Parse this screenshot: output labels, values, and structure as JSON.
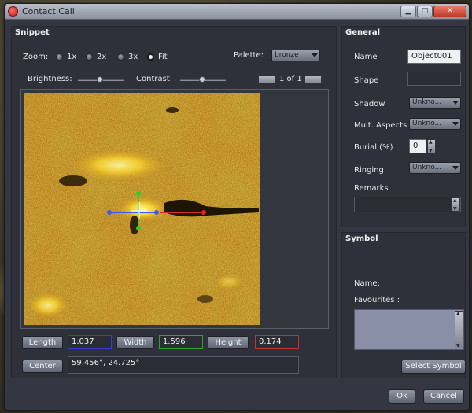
{
  "window": {
    "title": "Contact Call"
  },
  "snippet": {
    "header": "Snippet",
    "zoom_label": "Zoom:",
    "zoom_options": [
      "1x",
      "2x",
      "3x",
      "Fit"
    ],
    "zoom_selected": "Fit",
    "palette_label": "Palette:",
    "palette_value": "bronze",
    "brightness_label": "Brightness:",
    "contrast_label": "Contrast:",
    "page_indicator": "1 of 1",
    "length_button": "Length",
    "length_value": "1.037",
    "width_button": "Width",
    "width_value": "1.596",
    "height_button": "Height",
    "height_value": "0.174",
    "center_button": "Center",
    "center_value": "59.456°, 24.725°"
  },
  "general": {
    "header": "General",
    "name_label": "Name",
    "name_value": "Object001",
    "shape_label": "Shape",
    "shadow_label": "Shadow",
    "shadow_value": "Unkno...",
    "mult_aspects_label": "Mult. Aspects",
    "mult_aspects_value": "Unkno...",
    "burial_label": "Burial (%)",
    "burial_value": "0",
    "ringing_label": "Ringing",
    "ringing_value": "Unkno...",
    "remarks_label": "Remarks"
  },
  "symbol": {
    "header": "Symbol",
    "name_label": "Name:",
    "favourites_label": "Favourites :",
    "select_button": "Select Symbol"
  },
  "footer": {
    "ok": "Ok",
    "cancel": "Cancel"
  },
  "colors": {
    "length_border": "#3a3ad8",
    "width_border": "#2aa82a",
    "height_border": "#c83030",
    "sonar_base": "#b07818"
  }
}
